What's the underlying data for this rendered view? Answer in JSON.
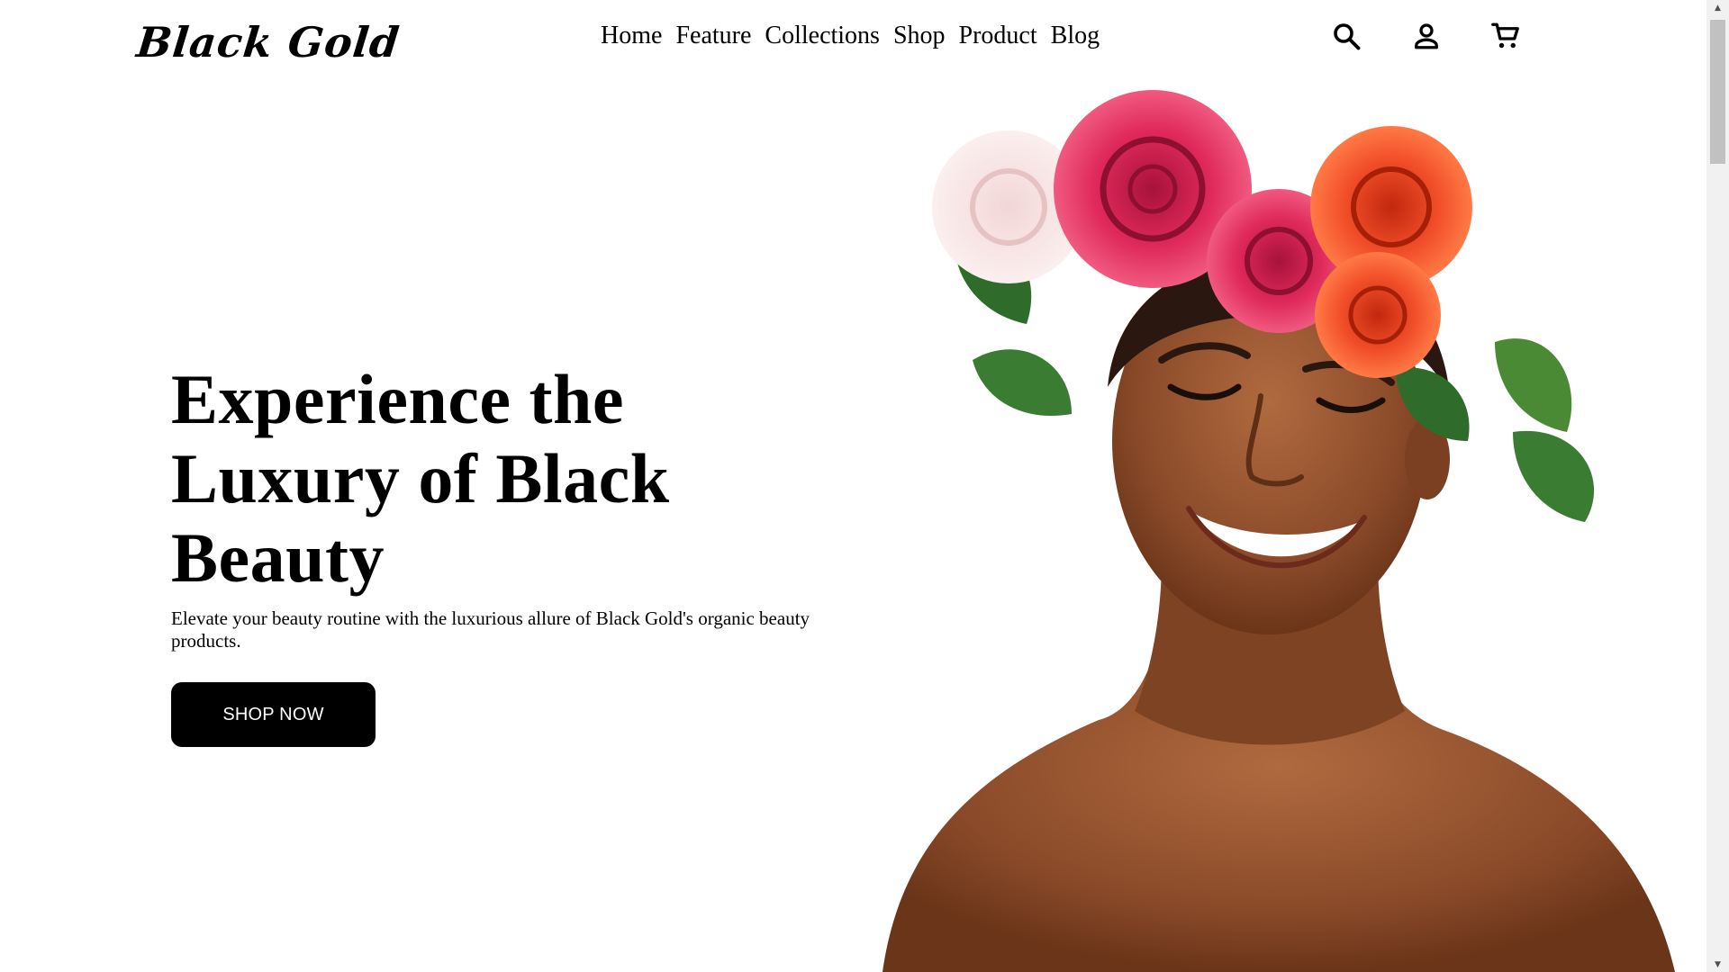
{
  "brand": {
    "name": "Black Gold"
  },
  "nav": {
    "items": [
      {
        "label": "Home"
      },
      {
        "label": "Feature"
      },
      {
        "label": "Collections"
      },
      {
        "label": "Shop"
      },
      {
        "label": "Product"
      },
      {
        "label": "Blog"
      }
    ]
  },
  "header_icons": {
    "search": "search-icon",
    "account": "user-icon",
    "cart": "cart-icon"
  },
  "hero": {
    "title_lines": [
      "Experience the",
      "Luxury of Black",
      "Beauty"
    ],
    "subtitle": "Elevate your beauty routine with the luxurious allure of Black Gold's organic beauty products.",
    "cta_label": "SHOP NOW"
  },
  "colors": {
    "background": "#ffffff",
    "text": "#000000",
    "button_bg": "#000000",
    "button_text": "#ffffff"
  }
}
